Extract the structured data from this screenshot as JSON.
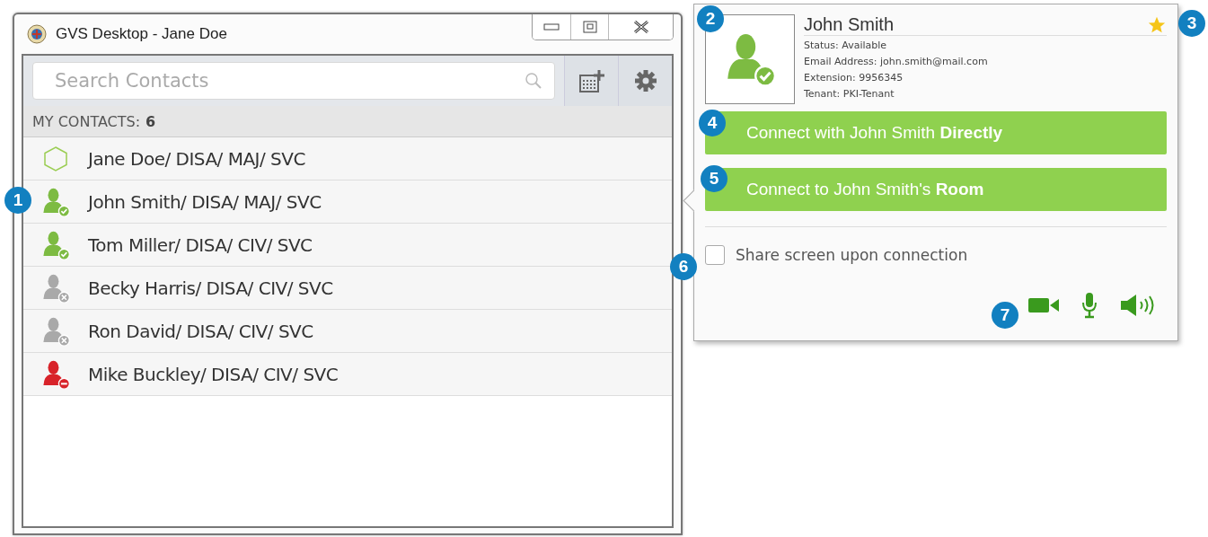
{
  "window": {
    "title": "GVS Desktop - Jane Doe"
  },
  "search": {
    "placeholder": "Search Contacts"
  },
  "contacts_header": {
    "label": "MY CONTACTS:",
    "count": "6"
  },
  "contacts": [
    {
      "name": "Jane Doe/ DISA/ MAJ/ SVC",
      "kind": "self"
    },
    {
      "name": "John Smith/ DISA/ MAJ/ SVC",
      "kind": "available"
    },
    {
      "name": "Tom Miller/ DISA/ CIV/ SVC",
      "kind": "available"
    },
    {
      "name": "Becky Harris/ DISA/ CIV/ SVC",
      "kind": "offline"
    },
    {
      "name": "Ron David/ DISA/ CIV/ SVC",
      "kind": "offline"
    },
    {
      "name": "Mike Buckley/ DISA/ CIV/ SVC",
      "kind": "busy"
    }
  ],
  "contact_card": {
    "name": "John Smith",
    "avatar": {
      "kind": "available"
    },
    "favorite": true,
    "details": [
      "Status: Available",
      "Email Address: john.smith@mail.com",
      "Extension: 9956345",
      "Tenant: PKI-Tenant"
    ],
    "buttons": [
      "Connect with John Smith **Directly**",
      "Connect to John Smith's **Room**"
    ],
    "share_screen": {
      "label": "Share screen upon connection",
      "checked": false
    }
  },
  "callouts": [
    "1",
    "2",
    "3",
    "4",
    "5",
    "6",
    "7"
  ]
}
